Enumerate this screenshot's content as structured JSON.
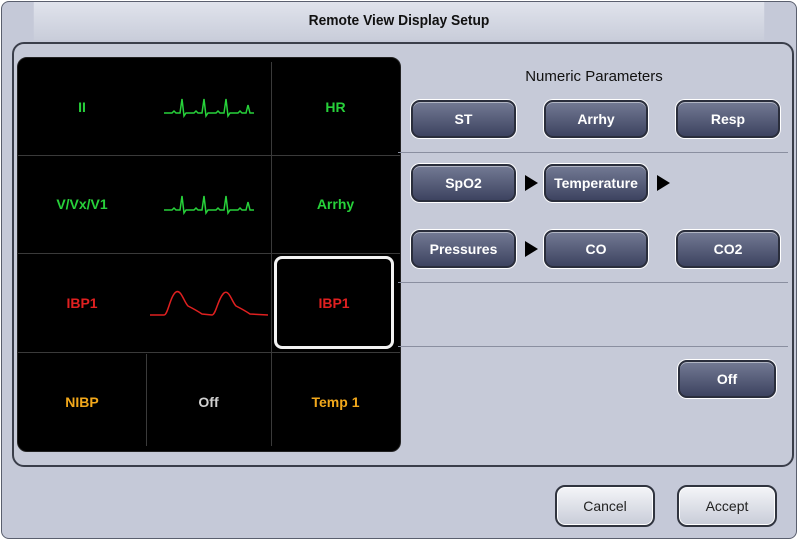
{
  "dialog": {
    "title": "Remote View Display Setup"
  },
  "grid": {
    "rows": [
      {
        "label": "II",
        "wave": "ecg",
        "param": "HR",
        "color": "#27d13a"
      },
      {
        "label": "V/Vx/V1",
        "wave": "ecg",
        "param": "Arrhy",
        "color": "#27d13a"
      },
      {
        "label": "IBP1",
        "wave": "ibp",
        "param": "IBP1",
        "color": "#e02020",
        "param_selected": true
      }
    ],
    "bottom": {
      "left": "NIBP",
      "middle": "Off",
      "right": "Temp 1"
    }
  },
  "numeric": {
    "header": "Numeric Parameters",
    "row1": [
      "ST",
      "Arrhy",
      "Resp"
    ],
    "row2": {
      "a": "SpO2",
      "b": "Temperature"
    },
    "row3": {
      "a": "Pressures",
      "b": "CO",
      "c": "CO2"
    },
    "off_label": "Off"
  },
  "footer": {
    "cancel": "Cancel",
    "accept": "Accept"
  },
  "colors": {
    "ecg": "#27d13a",
    "ibp": "#e02020",
    "nibp": "#f2a81b",
    "button": "#4a5170"
  }
}
